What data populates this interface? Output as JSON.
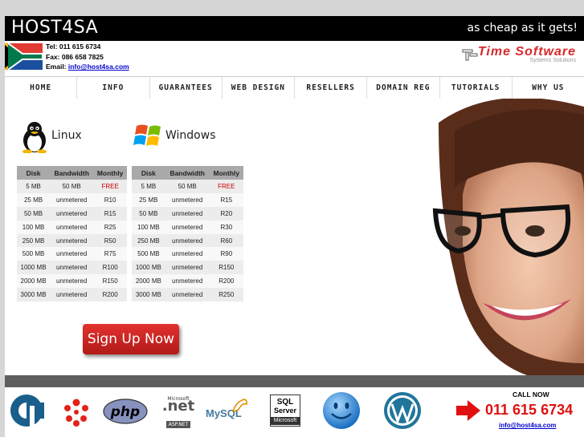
{
  "header": {
    "brand": "HOST4SA",
    "tagline": "as cheap as it gets!",
    "tel": "Tel: 011 615 6734",
    "fax": "Fax: 086 658 7825",
    "email_label": "Email: ",
    "email": "info@host4sa.com",
    "partner_name": "Time Software",
    "partner_sub": "Systems Solutions"
  },
  "nav": [
    "HOME",
    "INFO",
    "GUARANTEES",
    "WEB DESIGN",
    "RESELLERS",
    "DOMAIN REG",
    "TUTORIALS",
    "WHY US"
  ],
  "plans": {
    "linux": {
      "label": "Linux",
      "headers": [
        "Disk",
        "Bandwidth",
        "Monthly"
      ],
      "rows": [
        [
          "5 MB",
          "50 MB",
          "FREE"
        ],
        [
          "25 MB",
          "unmetered",
          "R10"
        ],
        [
          "50 MB",
          "unmetered",
          "R15"
        ],
        [
          "100 MB",
          "unmetered",
          "R25"
        ],
        [
          "250 MB",
          "unmetered",
          "R50"
        ],
        [
          "500 MB",
          "unmetered",
          "R75"
        ],
        [
          "1000 MB",
          "unmetered",
          "R100"
        ],
        [
          "2000 MB",
          "unmetered",
          "R150"
        ],
        [
          "3000 MB",
          "unmetered",
          "R200"
        ]
      ]
    },
    "windows": {
      "label": "Windows",
      "headers": [
        "Disk",
        "Bandwidth",
        "Monthly"
      ],
      "rows": [
        [
          "5 MB",
          "50 MB",
          "FREE"
        ],
        [
          "25 MB",
          "unmetered",
          "R15"
        ],
        [
          "50 MB",
          "unmetered",
          "R20"
        ],
        [
          "100 MB",
          "unmetered",
          "R30"
        ],
        [
          "250 MB",
          "unmetered",
          "R60"
        ],
        [
          "500 MB",
          "unmetered",
          "R90"
        ],
        [
          "1000 MB",
          "unmetered",
          "R150"
        ],
        [
          "2000 MB",
          "unmetered",
          "R200"
        ],
        [
          "3000 MB",
          "unmetered",
          "R250"
        ]
      ]
    }
  },
  "signup_label": "Sign Up Now",
  "footer": {
    "call_now": "CALL NOW",
    "phone": "011 615 6734",
    "email": "info@host4sa.com",
    "logos": {
      "php": "php",
      "aspnet_top": "Microsoft",
      "aspnet_main": ".net",
      "aspnet_badge": "ASP.NET",
      "mysql": "MySQL",
      "sql_top": "SQL",
      "sql_mid": "Server",
      "sql_bottom": "Microsoft"
    }
  },
  "colors": {
    "accent_red": "#e01010",
    "nav_bg": "#ffffff",
    "header_bg": "#000000"
  }
}
